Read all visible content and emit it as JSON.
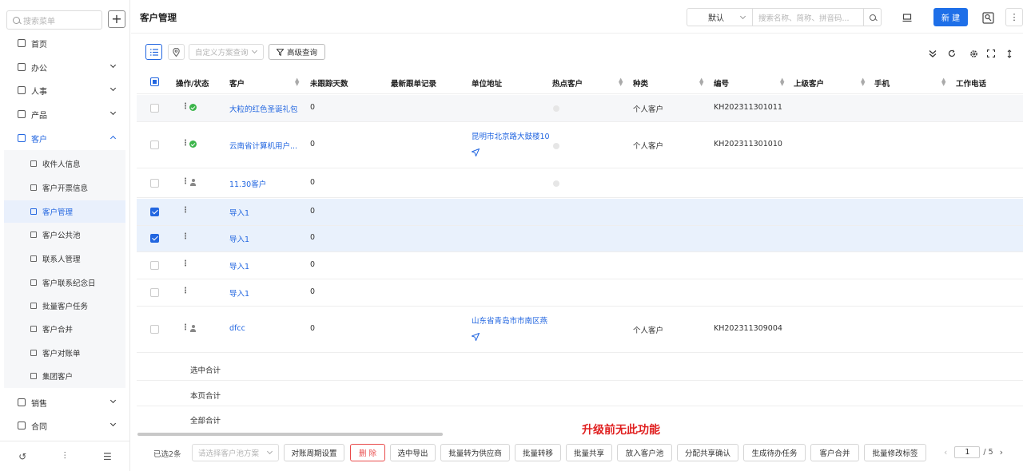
{
  "sidebar": {
    "search_placeholder": "搜索菜单",
    "add_label": "+",
    "menu": [
      {
        "label": "首页",
        "icon": "home-icon",
        "chev": false
      },
      {
        "label": "办公",
        "icon": "office-icon",
        "chev": true
      },
      {
        "label": "人事",
        "icon": "hr-icon",
        "chev": true
      },
      {
        "label": "产品",
        "icon": "product-icon",
        "chev": true
      },
      {
        "label": "客户",
        "icon": "customer-icon",
        "chev": true,
        "expanded": true
      }
    ],
    "sub_items": [
      "收件人信息",
      "客户开票信息",
      "客户管理",
      "客户公共池",
      "联系人管理",
      "客户联系纪念日",
      "批量客户任务",
      "客户合并",
      "客户对账单",
      "集团客户"
    ],
    "menu_after": [
      {
        "label": "销售",
        "icon": "sales-icon"
      },
      {
        "label": "合同",
        "icon": "contract-icon"
      }
    ],
    "footer_icons": [
      "history-icon",
      "settings-sliders-icon",
      "collapse-menu-icon"
    ]
  },
  "header": {
    "title": "客户管理",
    "scheme_value": "默认",
    "search_placeholder": "搜索名称、简称、拼音码...",
    "new_label": "新 建",
    "more_label": "⋮"
  },
  "toolbar": {
    "custom_query_placeholder": "自定义方案查询",
    "advanced_query_label": "高级查询"
  },
  "table": {
    "columns": [
      "操作/状态",
      "客户",
      "未跟踪天数",
      "最新跟单记录",
      "单位地址",
      "热点客户",
      "种类",
      "编号",
      "上级客户",
      "手机",
      "工作电话"
    ],
    "rows": [
      {
        "customer": "大粒的红色圣诞礼包",
        "days": "0",
        "address": "",
        "kind": "个人客户",
        "code": "KH202311301011",
        "status": "ok",
        "checked": false
      },
      {
        "customer": "云南省计算机用户...",
        "days": "0",
        "address": "昆明市北京路大鼓楼10",
        "kind": "个人客户",
        "code": "KH202311301010",
        "status": "ok",
        "checked": false
      },
      {
        "customer": "11.30客户",
        "days": "0",
        "address": "",
        "kind": "",
        "code": "",
        "status": "user",
        "checked": false
      },
      {
        "customer": "导入1",
        "days": "0",
        "address": "",
        "kind": "",
        "code": "",
        "status": "",
        "checked": true
      },
      {
        "customer": "导入1",
        "days": "0",
        "address": "",
        "kind": "",
        "code": "",
        "status": "",
        "checked": true
      },
      {
        "customer": "导入1",
        "days": "0",
        "address": "",
        "kind": "",
        "code": "",
        "status": "",
        "checked": false
      },
      {
        "customer": "导入1",
        "days": "0",
        "address": "",
        "kind": "",
        "code": "",
        "status": "",
        "checked": false
      },
      {
        "customer": "dfcc",
        "days": "0",
        "address": "山东省青岛市市南区燕",
        "kind": "个人客户",
        "code": "KH202311309004",
        "status": "user",
        "checked": false
      }
    ],
    "summary_rows": [
      "选中合计",
      "本页合计",
      "全部合计"
    ]
  },
  "footer": {
    "selected_count": "已选2条",
    "pool_placeholder": "请选择客户池方案",
    "buttons": [
      "对账周期设置",
      "删 除",
      "选中导出",
      "批量转为供应商",
      "批量转移",
      "批量共享",
      "放入客户池",
      "分配共享确认",
      "生成待办任务",
      "客户合并",
      "批量修改标签"
    ],
    "page_current": "1",
    "page_total": "/ 5",
    "prev": "‹",
    "next": "›"
  },
  "annotation": "升级前无此功能",
  "colors": {
    "primary": "#1e6fe8",
    "link": "#2266e0",
    "danger": "#e94b4b",
    "ok": "#3bb54a",
    "annotation": "#e02020"
  }
}
